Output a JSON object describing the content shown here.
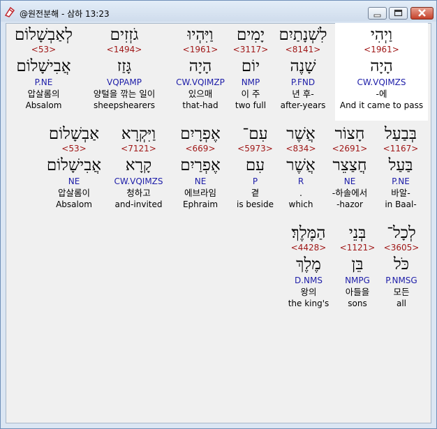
{
  "window": {
    "title": "@원전분해 - 삼하 13:23",
    "buttons": {
      "minimize": "minimize",
      "maximize": "maximize",
      "close": "close"
    }
  },
  "rows": [
    {
      "words": [
        {
          "hebrew": "וַיְהִי",
          "strong": "<1961>",
          "lemma": "הָיָה",
          "parse": "CW.VQIMZS",
          "korean": "-에",
          "english": "And it came to pass"
        },
        {
          "hebrew": "לִשְׁנָתַיִם",
          "strong": "<8141>",
          "lemma": "שָׁנֶה",
          "parse": "P.FND",
          "korean": "년 후-",
          "english": "after-years"
        },
        {
          "hebrew": "יָמִים",
          "strong": "<3117>",
          "lemma": "יוֹם",
          "parse": "NMP",
          "korean": "이 주",
          "english": "two full"
        },
        {
          "hebrew": "וַיִּהְיוּ",
          "strong": "<1961>",
          "lemma": "הָיָה",
          "parse": "CW.VQIMZP",
          "korean": "있으매",
          "english": "that-had"
        },
        {
          "hebrew": "גֹזְזִים",
          "strong": "<1494>",
          "lemma": "גָּזַז",
          "parse": "VQPAMP",
          "korean": "양털을 깎는 일이",
          "english": "sheepshearers"
        },
        {
          "hebrew": "לְאַבְשָׁלוֹם",
          "strong": "<53>",
          "lemma": "אֲבִישָׁלוֹם",
          "parse": "P.NE",
          "korean": "압살롬의",
          "english": "Absalom"
        }
      ]
    },
    {
      "words": [
        {
          "hebrew": "בְּבַעַל",
          "strong": "<1167>",
          "lemma": "בַּעַל",
          "parse": "P.NE",
          "korean": "바알-",
          "english": "in Baal-"
        },
        {
          "hebrew": "חָצוֹר",
          "strong": "<2691>",
          "lemma": "חֲצַצֵר",
          "parse": "NE",
          "korean": "-하솔에서",
          "english": "-hazor"
        },
        {
          "hebrew": "אֲשֶׁר",
          "strong": "<834>",
          "lemma": "אֲשֶׁר",
          "parse": "R",
          "korean": ".",
          "english": "which"
        },
        {
          "hebrew": "עִם־",
          "strong": "<5973>",
          "lemma": "עִם",
          "parse": "P",
          "korean": "곁",
          "english": "is beside"
        },
        {
          "hebrew": "אֶפְרָיִם",
          "strong": "<669>",
          "lemma": "אֶפְרַיִם",
          "parse": "NE",
          "korean": "에브라임",
          "english": "Ephraim"
        },
        {
          "hebrew": "וַיִּקְרָא",
          "strong": "<7121>",
          "lemma": "קָרָא",
          "parse": "CW.VQIMZS",
          "korean": "청하고",
          "english": "and-invited"
        },
        {
          "hebrew": "אַבְשָׁלוֹם",
          "strong": "<53>",
          "lemma": "אֲבִישָׁלוֹם",
          "parse": "NE",
          "korean": "압살롬이",
          "english": "Absalom"
        }
      ]
    },
    {
      "words": [
        {
          "hebrew": "לְכָל־",
          "strong": "<3605>",
          "lemma": "כֹּל",
          "parse": "P.NMSG",
          "korean": "모든",
          "english": "all"
        },
        {
          "hebrew": "בְּנֵי",
          "strong": "<1121>",
          "lemma": "בֵּן",
          "parse": "NMPG",
          "korean": "아들을",
          "english": "sons"
        },
        {
          "hebrew": "הַמֶּלֶךְ׃",
          "strong": "<4428>",
          "lemma": "מֶלֶךְ",
          "parse": "D.NMS",
          "korean": "왕의",
          "english": "the king's"
        }
      ]
    }
  ]
}
